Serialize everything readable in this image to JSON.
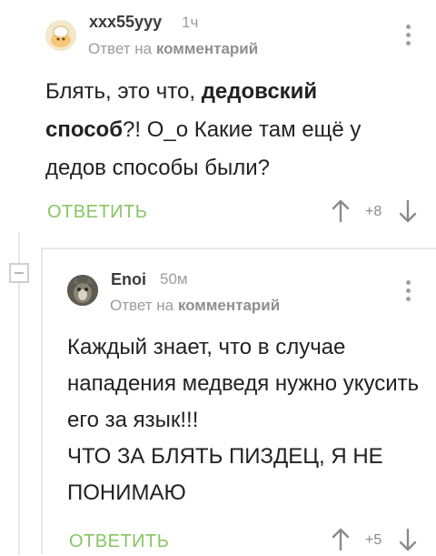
{
  "comment1": {
    "username": "xxx55yyy",
    "time": "1ч",
    "reply_prefix": "Ответ на",
    "reply_target": "комментарий",
    "text_part1": "Блять, это что, ",
    "text_bold": "дедовский способ",
    "text_part2": "?! О_о Какие там ещё у дедов способы были?",
    "reply_label": "ОТВЕТИТЬ",
    "score": "+8"
  },
  "comment2": {
    "username": "Enoi",
    "time": "50м",
    "reply_prefix": "Ответ на",
    "reply_target": "комментарий",
    "text_line1": "Каждый знает, что в случае нападения медведя нужно укусить его за язык!!!",
    "text_line2": "ЧТО ЗА БЛЯТЬ ПИЗДЕЦ, Я НЕ ПОНИМАЮ",
    "reply_label": "ОТВЕТИТЬ",
    "score": "+5"
  },
  "colors": {
    "accent_green": "#88c563",
    "meta_gray": "#9c9c9c",
    "text_dark": "#222222"
  },
  "icons": [
    "avatar",
    "kebab-menu-icon",
    "arrow-up-icon",
    "arrow-down-icon",
    "collapse-thread-icon"
  ]
}
